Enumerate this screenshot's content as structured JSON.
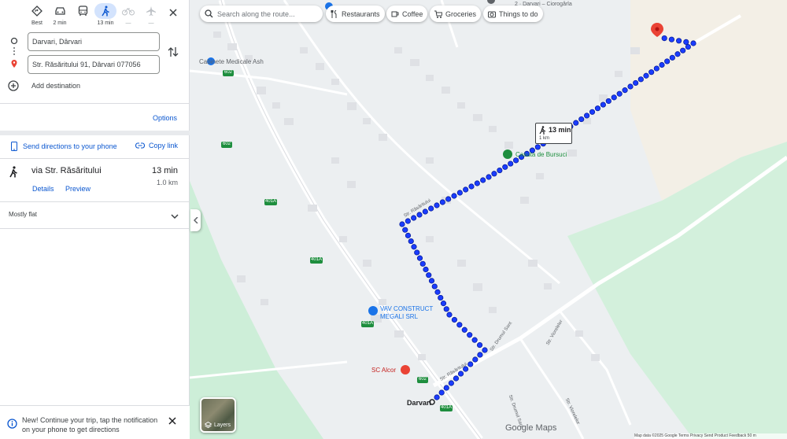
{
  "travel_modes": [
    {
      "name": "Best",
      "label": "Best",
      "icon": "diamond-route-icon"
    },
    {
      "name": "Driving",
      "label": "2 min",
      "icon": "car-icon"
    },
    {
      "name": "Transit",
      "label": "",
      "icon": "bus-icon"
    },
    {
      "name": "Walking",
      "label": "13 min",
      "icon": "walk-icon",
      "active": true
    },
    {
      "name": "Cycling",
      "label": "—",
      "icon": "bike-icon"
    },
    {
      "name": "Flights",
      "label": "—",
      "icon": "plane-icon"
    }
  ],
  "waypoints": {
    "start": "Darvari, Dârvari",
    "destination": "Str. Răsăritului 91, Dârvari 077056"
  },
  "add_destination_label": "Add destination",
  "options_label": "Options",
  "send_directions_label": "Send directions to your phone",
  "copy_link_label": "Copy link",
  "route": {
    "via": "via Str. Răsăritului",
    "time": "13 min",
    "distance": "1.0 km",
    "details_label": "Details",
    "preview_label": "Preview",
    "elevation": "Mostly flat"
  },
  "notification": {
    "message": "New! Continue your trip, tap the notification on your phone to get directions"
  },
  "map": {
    "search_placeholder": "Search along the route...",
    "chips": [
      {
        "label": "Restaurants",
        "icon": "restaurant-icon"
      },
      {
        "label": "Coffee",
        "icon": "coffee-icon"
      },
      {
        "label": "Groceries",
        "icon": "cart-icon"
      },
      {
        "label": "Things to do",
        "icon": "camera-icon"
      }
    ],
    "tooltip_time": "13 min",
    "tooltip_distance": "1 km",
    "layers_label": "Layers",
    "logo": "Google Maps",
    "labels": {
      "cabinete": "Cabinete Medicale Ash",
      "casuta": "Casuta de Bursuci",
      "vav_line1": "VAV CONSTRUCT",
      "vav_line2": "MEGALI SRL",
      "sc_alcor": "SC Alcor",
      "darvari": "Darvari",
      "darvari_top": "2 · Darvari – Ciorogârla",
      "road_602a": "602",
      "road_602b": "602",
      "road_602c": "602",
      "road_401a_1": "401A",
      "road_401a_2": "401A",
      "road_401a_3": "401A",
      "road_401a_4": "401A",
      "street_rasaritului": "Str. Răsăritului",
      "street_rasaritului2": "Str. Răsăritului",
      "street_drumul_satnt": "Str. Drumul Sant",
      "street_drumul_sant": "Str. Drumul Sant",
      "street_viorelelor": "Str. Viorelelor",
      "street_viorelelor2": "Str. Viorelelor"
    },
    "attribution": "Map data ©2025  Google  Terms  Privacy  Send Product Feedback  50 m"
  },
  "colors": {
    "route": "#1a3cff",
    "accent": "#0b57d0",
    "destination_pin": "#ea4335",
    "park_green": "#c9ecd6"
  }
}
